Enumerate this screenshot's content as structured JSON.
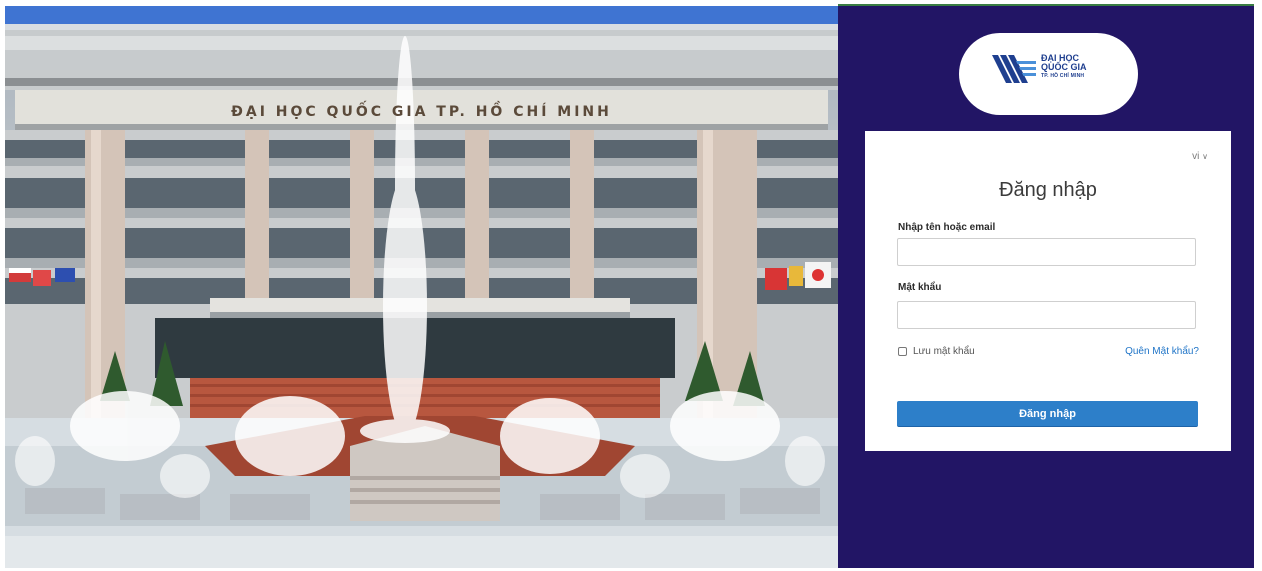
{
  "photo": {
    "building_sign": "ĐẠI HỌC QUỐC GIA TP. HỒ CHÍ MINH"
  },
  "logo": {
    "line1": "ĐẠI HỌC",
    "line2": "QUỐC GIA",
    "line3": "TP. HỒ CHÍ MINH"
  },
  "login": {
    "language": "vi",
    "title": "Đăng nhập",
    "username_label": "Nhập tên hoặc email",
    "username_value": "",
    "password_label": "Mật khẩu",
    "password_value": "",
    "remember_label": "Lưu mật khẩu",
    "forgot_label": "Quên Mật khẩu?",
    "submit_label": "Đăng nhập"
  },
  "colors": {
    "panel_bg": "#221565",
    "button": "#2d7fc9",
    "link": "#1f74c7"
  }
}
